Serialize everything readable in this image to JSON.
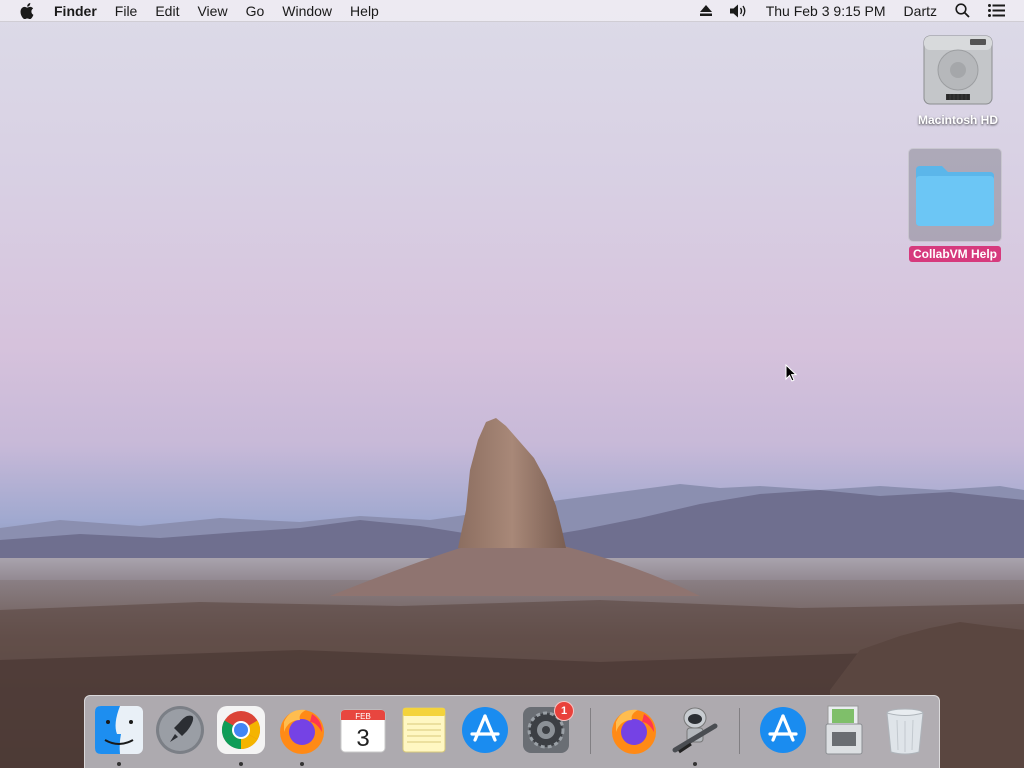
{
  "menubar": {
    "app_name": "Finder",
    "menus": [
      "File",
      "Edit",
      "View",
      "Go",
      "Window",
      "Help"
    ],
    "datetime": "Thu Feb 3  9:15 PM",
    "user": "Dartz"
  },
  "desktop_icons": {
    "hd_label": "Macintosh HD",
    "folder_label": "CollabVM Help"
  },
  "dock": {
    "items": [
      {
        "name": "Finder",
        "icon": "finder-icon",
        "running": true
      },
      {
        "name": "Launchpad",
        "icon": "launchpad-icon",
        "running": false
      },
      {
        "name": "Google Chrome",
        "icon": "chrome-icon",
        "running": true
      },
      {
        "name": "Firefox",
        "icon": "firefox-icon",
        "running": true
      },
      {
        "name": "Calendar",
        "icon": "calendar-icon",
        "running": false
      },
      {
        "name": "Notes",
        "icon": "notes-icon",
        "running": false
      },
      {
        "name": "App Store",
        "icon": "app-store-icon",
        "running": false
      },
      {
        "name": "System Preferences",
        "icon": "system-preferences-icon",
        "running": false
      },
      {
        "name": "Firefox",
        "icon": "firefox-icon",
        "running": false
      },
      {
        "name": "Automator",
        "icon": "automator-icon",
        "running": true
      },
      {
        "name": "App Store",
        "icon": "app-store-icon",
        "running": false
      },
      {
        "name": "Installer",
        "icon": "installer-icon",
        "running": false
      },
      {
        "name": "Trash",
        "icon": "trash-icon",
        "running": false
      }
    ],
    "calendar_month": "FEB",
    "calendar_day": "3",
    "sysprefs_badge": "1"
  },
  "colors": {
    "selection_label": "#d63a7d",
    "folder_blue": "#6cc6f5",
    "badge_red": "#e9413b"
  }
}
